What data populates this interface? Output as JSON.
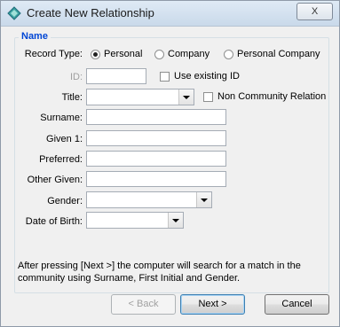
{
  "window": {
    "title": "Create New Relationship",
    "close_label": "X"
  },
  "group": {
    "title": "Name"
  },
  "record_type": {
    "label": "Record Type:",
    "options": [
      {
        "label": "Personal",
        "checked": true
      },
      {
        "label": "Company",
        "checked": false
      },
      {
        "label": "Personal Company",
        "checked": false
      }
    ]
  },
  "id_field": {
    "label": "ID:",
    "value": ""
  },
  "use_existing_id": {
    "label": "Use existing ID",
    "checked": false
  },
  "title_field": {
    "label": "Title:",
    "value": ""
  },
  "non_community": {
    "label": "Non Community Relation",
    "checked": false
  },
  "surname": {
    "label": "Surname:",
    "value": ""
  },
  "given1": {
    "label": "Given 1:",
    "value": ""
  },
  "preferred": {
    "label": "Preferred:",
    "value": ""
  },
  "other_given": {
    "label": "Other Given:",
    "value": ""
  },
  "gender": {
    "label": "Gender:",
    "value": ""
  },
  "dob": {
    "label": "Date of Birth:",
    "value": ""
  },
  "note": "After pressing [Next >] the computer will search for a match in the community using Surname, First Initial and Gender.",
  "buttons": {
    "back": "< Back",
    "next": "Next >",
    "cancel": "Cancel"
  }
}
